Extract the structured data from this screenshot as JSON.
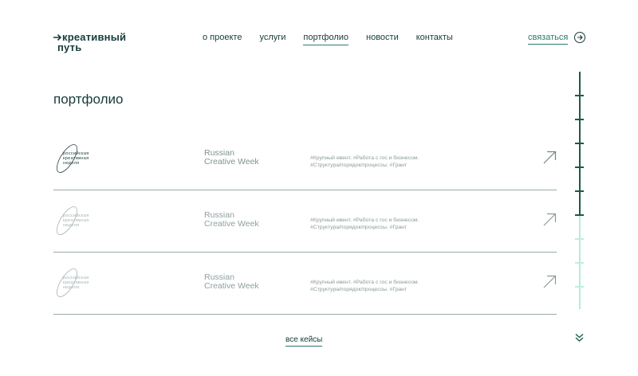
{
  "brand": {
    "line1": "креативный",
    "line2": "путь"
  },
  "nav": {
    "items": [
      "о проекте",
      "услуги",
      "портфолио",
      "новости",
      "контакты"
    ],
    "active": "портфолио"
  },
  "header": {
    "contact_label": "связаться"
  },
  "page": {
    "title": "портфолио"
  },
  "portfolio": {
    "items": [
      {
        "badge_line1": "российская",
        "badge_line2": "креативная",
        "badge_line3": "неделя",
        "title_line1": "Russian",
        "title_line2": "Creative Week",
        "tags_line1": "#Крупный ивент.  #Работа с гос и бизнесом.",
        "tags_line2": "#Структура/порядок/процессы.  #Грант"
      },
      {
        "badge_line1": "российская",
        "badge_line2": "креативная",
        "badge_line3": "неделя",
        "title_line1": "Russian",
        "title_line2": "Creative Week",
        "tags_line1": "#Крупный ивент.  #Работа с гос и бизнесом.",
        "tags_line2": "#Структура/порядок/процессы.  #Грант"
      },
      {
        "badge_line1": "российская",
        "badge_line2": "креативная",
        "badge_line3": "неделя",
        "title_line1": "Russian",
        "title_line2": "Creative Week",
        "tags_line1": "#Крупный ивент.  #Работа с гос и бизнесом.",
        "tags_line2": "#Структура/порядок/процессы.  #Грант"
      }
    ],
    "all_cases_label": "все кейсы"
  },
  "icons": {
    "logo_arrow": "arrow-right-icon",
    "contact": "arrow-right-circle-icon",
    "open_case": "arrow-up-right-icon",
    "scroll_down": "double-chevron-down-icon"
  },
  "colors": {
    "text_dark": "#173a3a",
    "accent": "#2a7a66",
    "muted": "#8a9a9a",
    "rail_dark": "#1b5a4a",
    "rail_light": "#b8ead8"
  }
}
